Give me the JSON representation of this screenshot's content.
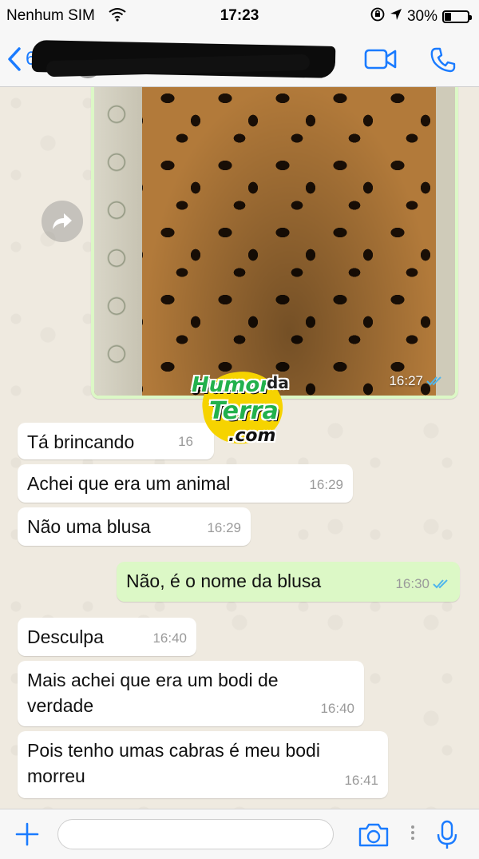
{
  "status_bar": {
    "carrier": "Nenhum SIM",
    "time": "17:23",
    "battery": "30%",
    "battery_level": 0.3
  },
  "nav": {
    "back_count": "6",
    "contact_name": "[redacted]"
  },
  "photo_message": {
    "time": "16:27",
    "read": true
  },
  "watermark": {
    "line1": "Humor",
    "line2": "da",
    "line3": "Terra",
    "line4": ".com"
  },
  "messages": [
    {
      "direction": "in",
      "text": "Tá brincando",
      "time": "16"
    },
    {
      "direction": "in",
      "text": "Achei que era um animal",
      "time": "16:29"
    },
    {
      "direction": "in",
      "text": "Não uma blusa",
      "time": "16:29"
    },
    {
      "direction": "out",
      "text": "Não, é o nome da blusa",
      "time": "16:30"
    },
    {
      "direction": "in",
      "text": "Desculpa",
      "time": "16:40"
    },
    {
      "direction": "in",
      "text": "Mais achei que era um bodi de verdade",
      "time": "16:40"
    },
    {
      "direction": "in",
      "text": "Pois tenho umas cabras é meu bodi morreu",
      "time": "16:41"
    }
  ],
  "input_bar": {
    "placeholder": ""
  },
  "colors": {
    "accent": "#1a7bff",
    "outgoing_bubble": "#dcf8c6",
    "incoming_bubble": "#ffffff",
    "read_ticks": "#4fb6ec"
  }
}
